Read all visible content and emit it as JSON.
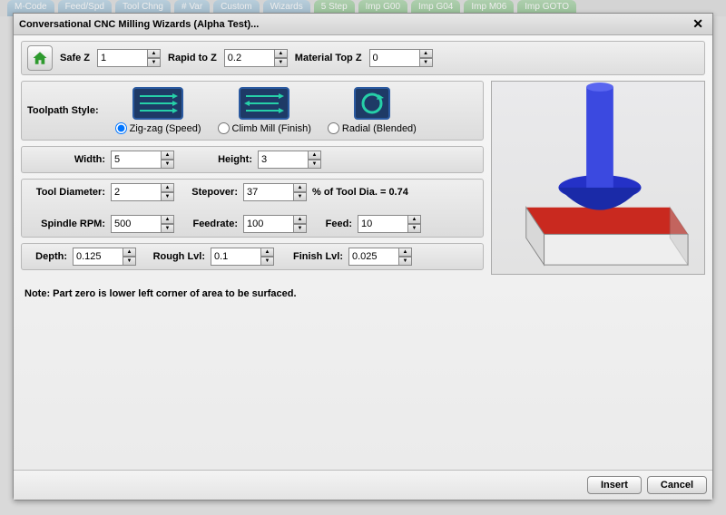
{
  "bg_tabs": [
    "M-Code",
    "Feed/Spd",
    "Tool Chng",
    "# Var",
    "Custom",
    "Wizards",
    "5 Step",
    "Imp G00",
    "Imp G04",
    "Imp M06",
    "Imp GOTO"
  ],
  "title": "Conversational CNC Milling Wizards (Alpha Test)...",
  "topbar": {
    "safe_z_label": "Safe Z",
    "safe_z_value": "1",
    "rapid_label": "Rapid to Z",
    "rapid_value": "0.2",
    "mat_top_label": "Material Top Z",
    "mat_top_value": "0"
  },
  "toolpath": {
    "label": "Toolpath Style:",
    "opt1": "Zig-zag (Speed)",
    "opt2": "Climb Mill (Finish)",
    "opt3": "Radial (Blended)"
  },
  "dims": {
    "width_label": "Width:",
    "width_value": "5",
    "height_label": "Height:",
    "height_value": "3"
  },
  "tool": {
    "diam_label": "Tool Diameter:",
    "diam_value": "2",
    "stepover_label": "Stepover:",
    "stepover_value": "37",
    "stepover_note": "% of Tool Dia. = 0.74",
    "rpm_label": "Spindle RPM:",
    "rpm_value": "500",
    "feedrate_label": "Feedrate:",
    "feedrate_value": "100",
    "feed_label": "Feed:",
    "feed_value": "10"
  },
  "depth": {
    "depth_label": "Depth:",
    "depth_value": "0.125",
    "rough_label": "Rough Lvl:",
    "rough_value": "0.1",
    "finish_label": "Finish Lvl:",
    "finish_value": "0.025"
  },
  "note": "Note:  Part zero is lower left corner of area to be surfaced.",
  "footer": {
    "insert": "Insert",
    "cancel": "Cancel"
  }
}
